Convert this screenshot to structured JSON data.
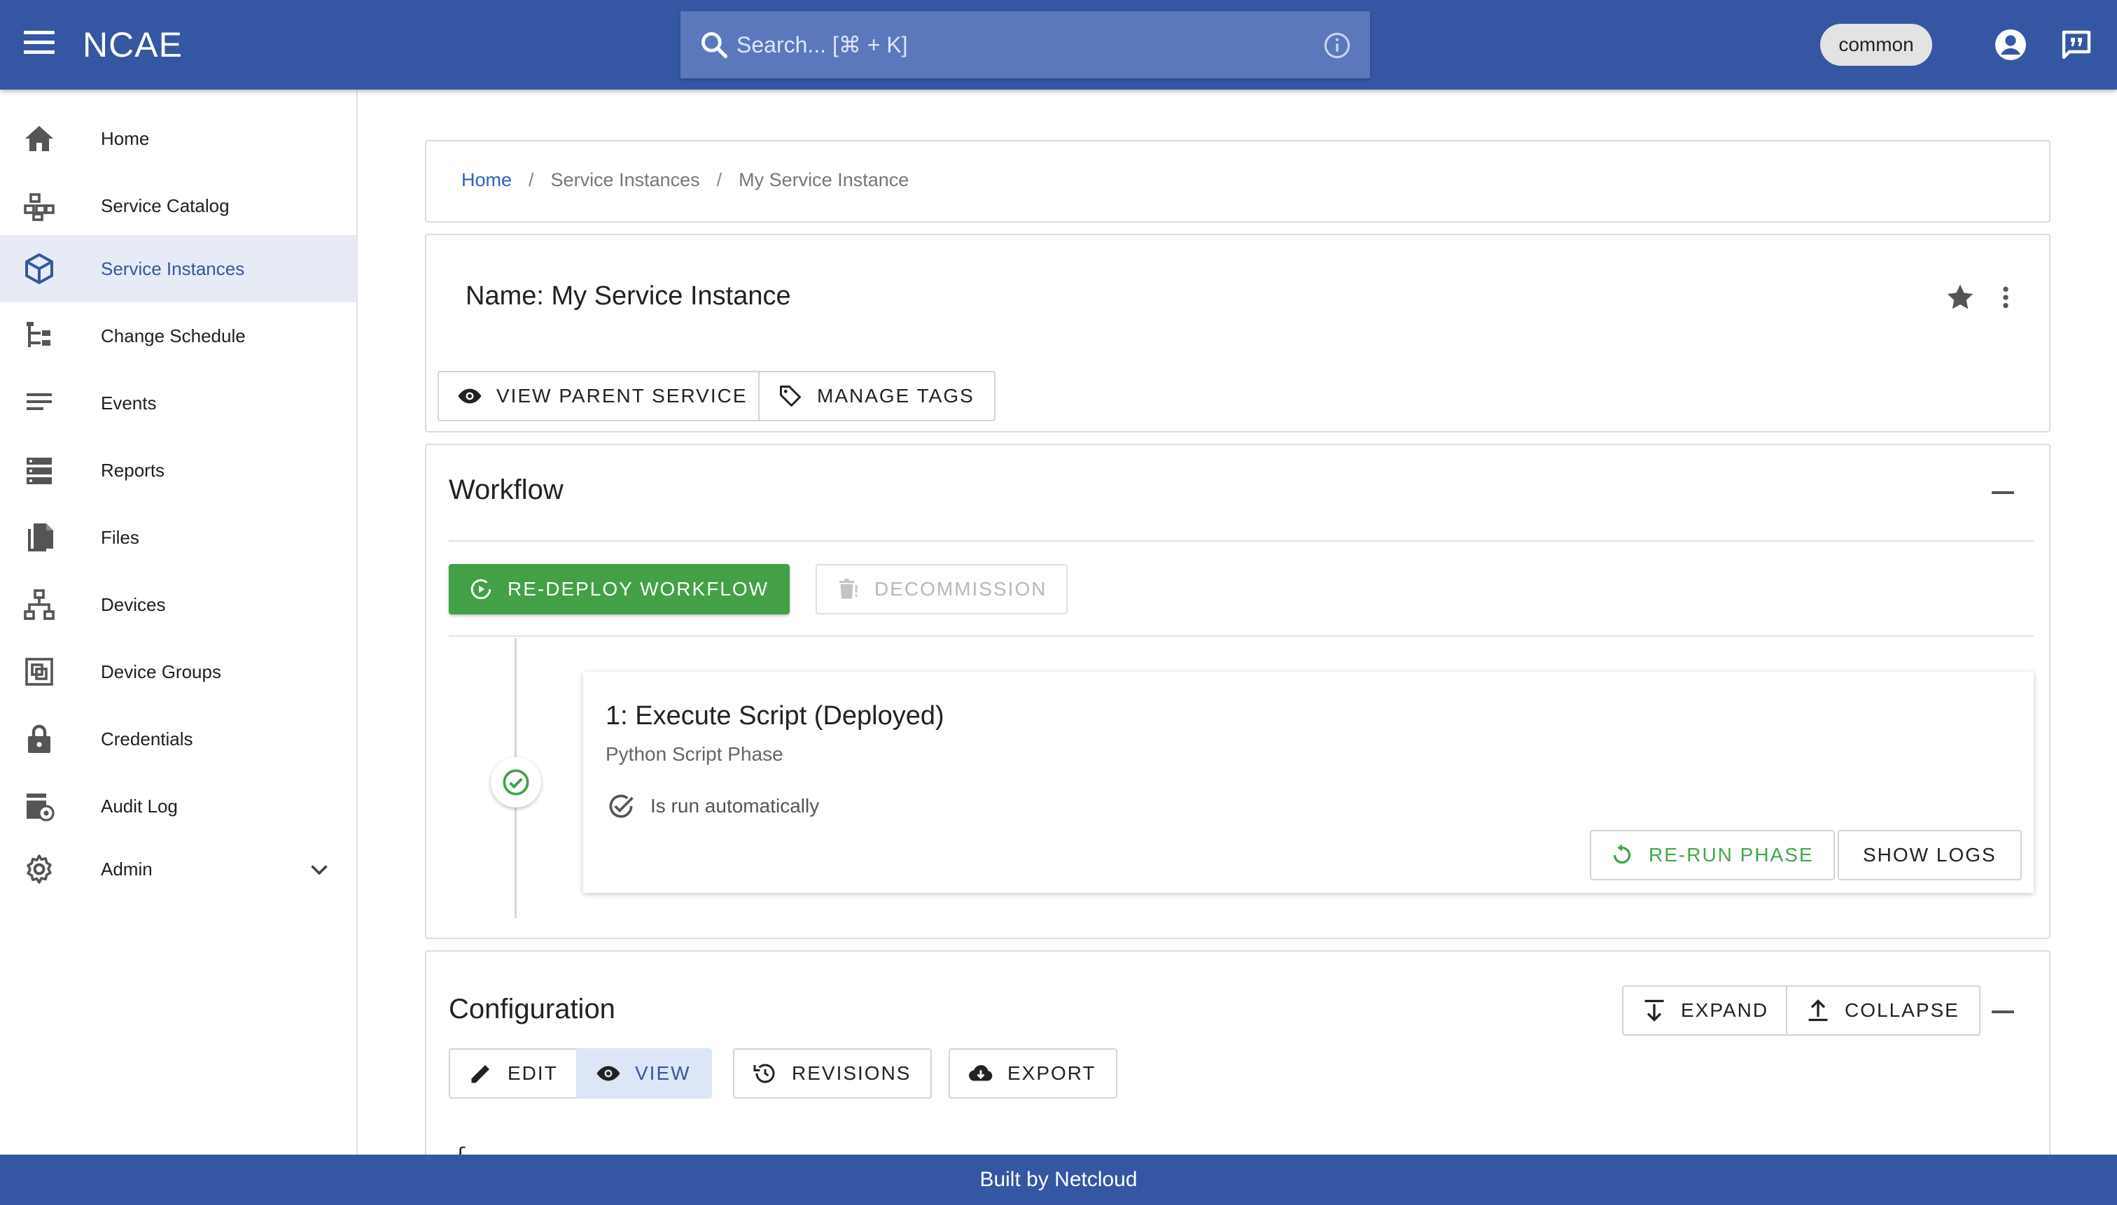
{
  "header": {
    "logo_text": "NCAE",
    "search_placeholder": "Search... [⌘ + K]",
    "namespace_chip": "common",
    "brand_color": "#3556a3"
  },
  "sidebar": {
    "items": [
      {
        "label": "Home",
        "icon": "home-icon",
        "active": false
      },
      {
        "label": "Service Catalog",
        "icon": "service-catalog-icon",
        "active": false
      },
      {
        "label": "Service Instances",
        "icon": "cube-icon",
        "active": true
      },
      {
        "label": "Change Schedule",
        "icon": "tree-icon",
        "active": false
      },
      {
        "label": "Events",
        "icon": "list-lines-icon",
        "active": false
      },
      {
        "label": "Reports",
        "icon": "server-icon",
        "active": false
      },
      {
        "label": "Files",
        "icon": "files-icon",
        "active": false
      },
      {
        "label": "Devices",
        "icon": "network-icon",
        "active": false
      },
      {
        "label": "Device Groups",
        "icon": "device-groups-icon",
        "active": false
      },
      {
        "label": "Credentials",
        "icon": "lock-icon",
        "active": false
      },
      {
        "label": "Audit Log",
        "icon": "audit-log-icon",
        "active": false
      },
      {
        "label": "Admin",
        "icon": "gear-icon",
        "active": false
      }
    ]
  },
  "breadcrumb": {
    "home": "Home",
    "service_instances": "Service Instances",
    "current": "My Service Instance",
    "separator": "/"
  },
  "instance": {
    "title": "Name: My Service Instance",
    "view_parent_label": "VIEW PARENT SERVICE",
    "manage_tags_label": "MANAGE TAGS"
  },
  "workflow": {
    "title": "Workflow",
    "redeploy_label": "RE-DEPLOY WORKFLOW",
    "decommission_label": "DECOMMISSION",
    "phase": {
      "title": "1: Execute Script (Deployed)",
      "subtitle": "Python Script Phase",
      "auto_label": "Is run automatically",
      "rerun_label": "RE-RUN PHASE",
      "logs_label": "SHOW LOGS",
      "status_color": "#43a047"
    }
  },
  "configuration": {
    "title": "Configuration",
    "expand_label": "EXPAND",
    "collapse_label": "COLLAPSE",
    "edit_label": "EDIT",
    "view_label": "VIEW",
    "revisions_label": "REVISIONS",
    "export_label": "EXPORT",
    "json_preview": "{"
  },
  "footer": {
    "text": "Built by Netcloud"
  }
}
